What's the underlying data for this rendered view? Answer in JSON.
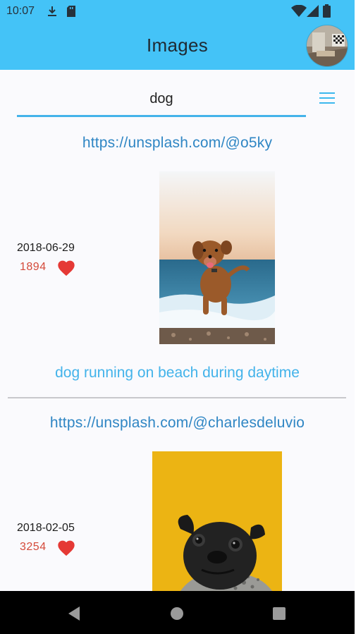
{
  "status_bar": {
    "time": "10:07",
    "icons": [
      "download-icon",
      "sd-card-icon",
      "wifi-icon",
      "cellular-signal-icon",
      "battery-icon"
    ]
  },
  "app_bar": {
    "title": "Images",
    "avatar": "profile-avatar"
  },
  "search": {
    "value": "dog",
    "placeholder": ""
  },
  "menu": {
    "icon": "hamburger-menu-icon"
  },
  "feed": [
    {
      "author_url": "https://unsplash.com/@o5ky",
      "date": "2018-06-29",
      "likes": "1894",
      "caption": "dog running on beach during daytime"
    },
    {
      "author_url": "https://unsplash.com/@charlesdeluvio",
      "date": "2018-02-05",
      "likes": "3254",
      "caption": ""
    }
  ],
  "nav_bar": {
    "buttons": [
      "back-icon",
      "home-icon",
      "recents-icon"
    ]
  },
  "colors": {
    "app_bar": "#44c3f7",
    "accent": "#44b3ea",
    "link": "#2f86c4",
    "likes": "#d44a3a",
    "heart": "#e53935"
  }
}
